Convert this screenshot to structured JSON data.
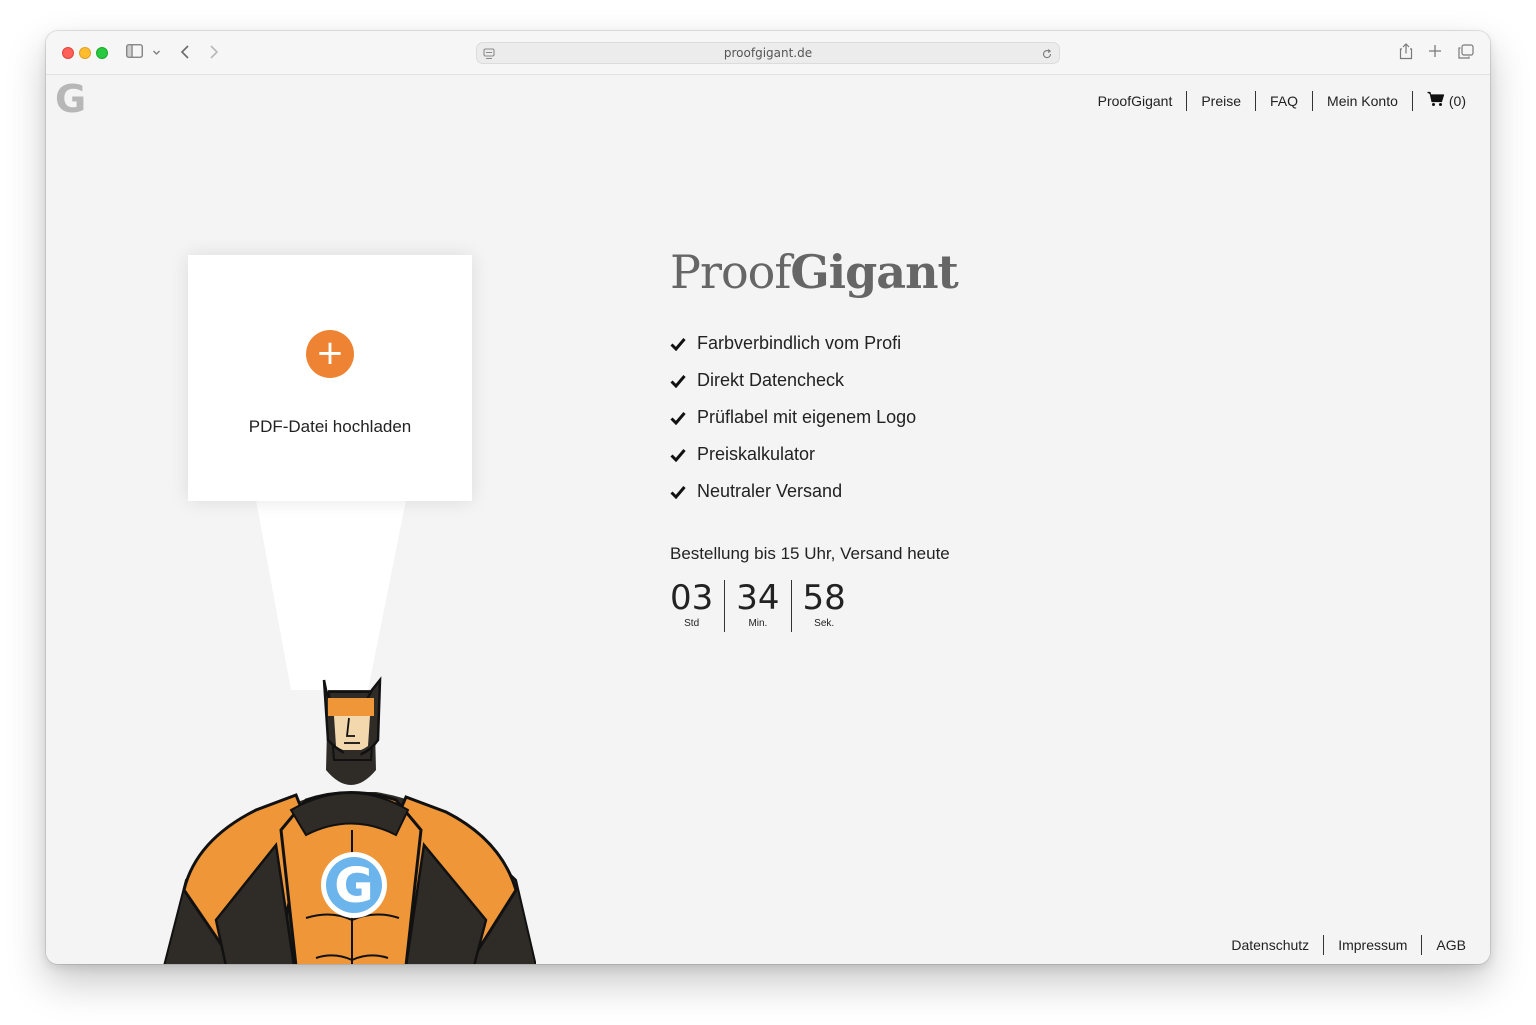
{
  "browser": {
    "url": "proofgigant.de"
  },
  "logo": {
    "letter": "G"
  },
  "nav": {
    "items": [
      "ProofGigant",
      "Preise",
      "FAQ",
      "Mein Konto"
    ],
    "cart_label": "(0)"
  },
  "upload": {
    "plus": "+",
    "label": "PDF-Datei hochladen"
  },
  "brand": {
    "light": "Proof",
    "bold": "Gigant"
  },
  "features": [
    "Farbverbindlich vom Profi",
    "Direkt Datencheck",
    "Prüflabel mit eigenem Logo",
    "Preiskalkulator",
    "Neutraler Versand"
  ],
  "order": {
    "text": "Bestellung bis 15 Uhr, Versand heute",
    "countdown": [
      {
        "value": "03",
        "label": "Std"
      },
      {
        "value": "34",
        "label": "Min."
      },
      {
        "value": "58",
        "label": "Sek."
      }
    ]
  },
  "footer": {
    "items": [
      "Datenschutz",
      "Impressum",
      "AGB"
    ]
  },
  "colors": {
    "accent": "#ee8433",
    "hero_blue": "#6bb4ec",
    "dark": "#2f2c28"
  }
}
